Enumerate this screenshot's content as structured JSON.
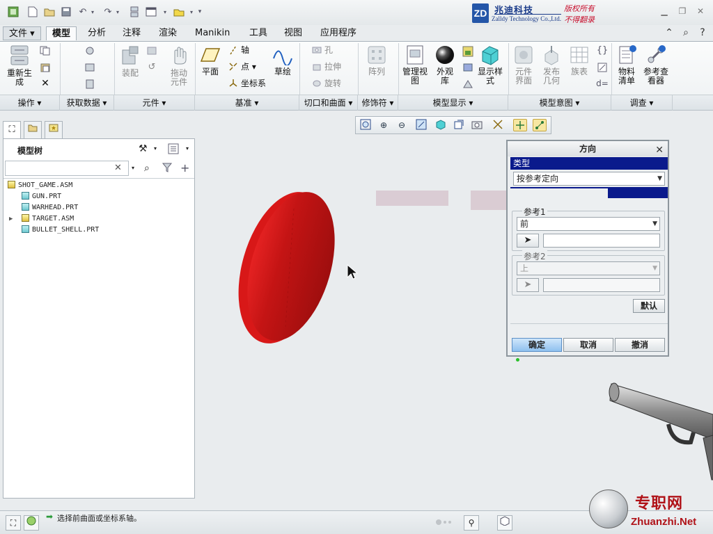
{
  "app": {
    "brand_cn": "兆迪科技",
    "brand_en": "Zalldy Technology Co.,Ltd.",
    "brand_right_1": "版权所有",
    "brand_right_2": "不得翻录",
    "brand_logo": "ZD"
  },
  "menu": {
    "file": "文件",
    "tabs": [
      "模型",
      "分析",
      "注释",
      "渲染",
      "Manikin",
      "工具",
      "视图",
      "应用程序"
    ],
    "active_tab": "模型"
  },
  "ribbon": {
    "regen": "重新生成",
    "assemble": "装配",
    "drag": "拖动元件",
    "plane": "平面",
    "axis": "轴",
    "point": "点",
    "csys": "坐标系",
    "sketch": "草绘",
    "hole": "孔",
    "extrude": "拉伸",
    "revolve": "旋转",
    "pattern": "阵列",
    "manage_views": "管理视图",
    "appearance": "外观库",
    "display_style": "显示样式",
    "comp_interface": "元件界面",
    "publish_geom": "发布几何",
    "family_table": "族表",
    "bom": "物料清单",
    "ref_viewer": "参考查看器",
    "groups": [
      "操作",
      "获取数据",
      "元件",
      "基准",
      "切口和曲面",
      "修饰符",
      "模型显示",
      "模型意图",
      "调查"
    ]
  },
  "tree": {
    "title": "模型树",
    "search_clear": "✕",
    "items": [
      "SHOT_GAME.ASM",
      "GUN.PRT",
      "WARHEAD.PRT",
      "TARGET.ASM",
      "BULLET_SHELL.PRT"
    ]
  },
  "dialog": {
    "title": "方向",
    "type_header": "类型",
    "type_value": "按参考定向",
    "ref1_label": "参考1",
    "ref1_value": "前",
    "ref2_label": "参考2",
    "ref2_value": "上",
    "default_btn": "默认",
    "ok_btn": "确定",
    "cancel_btn": "取消",
    "undo_btn": "撤消"
  },
  "status": {
    "message": "选择前曲面或坐标系轴。"
  },
  "watermark": {
    "cn": "专职网",
    "en": "Zhuanzhi.Net"
  },
  "colors": {
    "accent_navy": "#0a1a8c",
    "target_red": "#c41414",
    "brand_blue": "#1a3b8a",
    "brand_red": "#c8102e"
  }
}
